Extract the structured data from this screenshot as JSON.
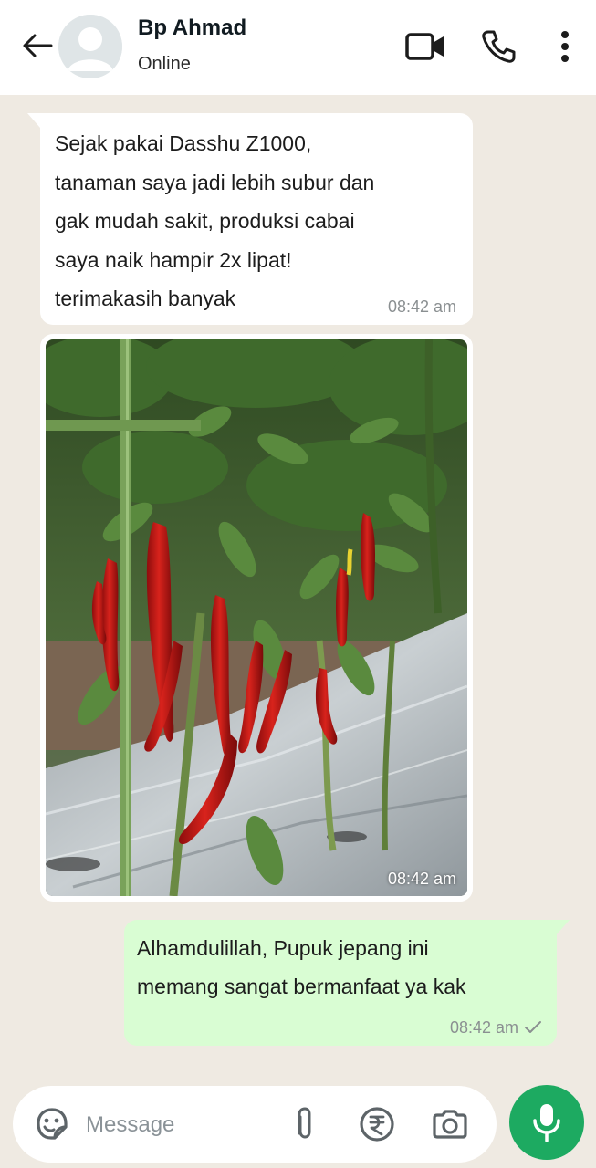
{
  "header": {
    "contact_name": "Bp Ahmad",
    "status": "Online",
    "icons": [
      "back-arrow-icon",
      "video-call-icon",
      "phone-icon",
      "more-options-icon"
    ]
  },
  "messages": [
    {
      "direction": "incoming",
      "text": "Sejak pakai Dasshu Z1000,\ntanaman saya jadi lebih subur dan\ngak mudah sakit, produksi cabai\nsaya naik hampir 2x lipat!\nterimakasih banyak",
      "time": "08:42 am"
    },
    {
      "direction": "incoming",
      "type": "image",
      "image_subject": "red chili plants",
      "time": "08:42 am"
    },
    {
      "direction": "outgoing",
      "text": "Alhamdulillah, Pupuk jepang ini\nmemang sangat bermanfaat ya kak",
      "time": "08:42 am",
      "status_icon": "sent-check-icon"
    }
  ],
  "composer": {
    "placeholder": "Message",
    "icons": [
      "sticker-icon",
      "attach-icon",
      "rupee-payment-icon",
      "camera-icon",
      "mic-icon"
    ]
  },
  "colors": {
    "chat_background": "#efeae2",
    "incoming_bubble": "#ffffff",
    "outgoing_bubble": "#d9fdd3",
    "mic_button": "#1daa61"
  }
}
